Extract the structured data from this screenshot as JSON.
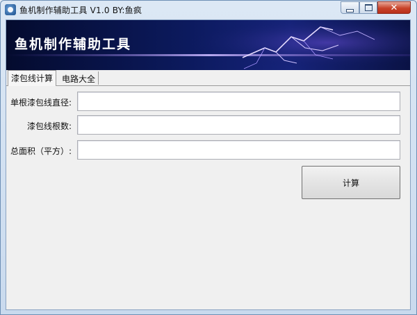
{
  "window": {
    "title": "鱼机制作辅助工具 V1.0   BY:鱼疯"
  },
  "banner": {
    "title": "鱼机制作辅助工具"
  },
  "tabs": [
    {
      "label": "漆包线计算",
      "active": true
    },
    {
      "label": "电路大全",
      "active": false
    }
  ],
  "form": {
    "diameter_label": "单根漆包线直径:",
    "diameter_value": "",
    "count_label": "漆包线根数:",
    "count_value": "",
    "area_label": "总面积（平方）:",
    "area_value": "",
    "calc_button": "计算"
  },
  "colors": {
    "banner_dark": "#040b2e",
    "close_button": "#c8432a"
  }
}
